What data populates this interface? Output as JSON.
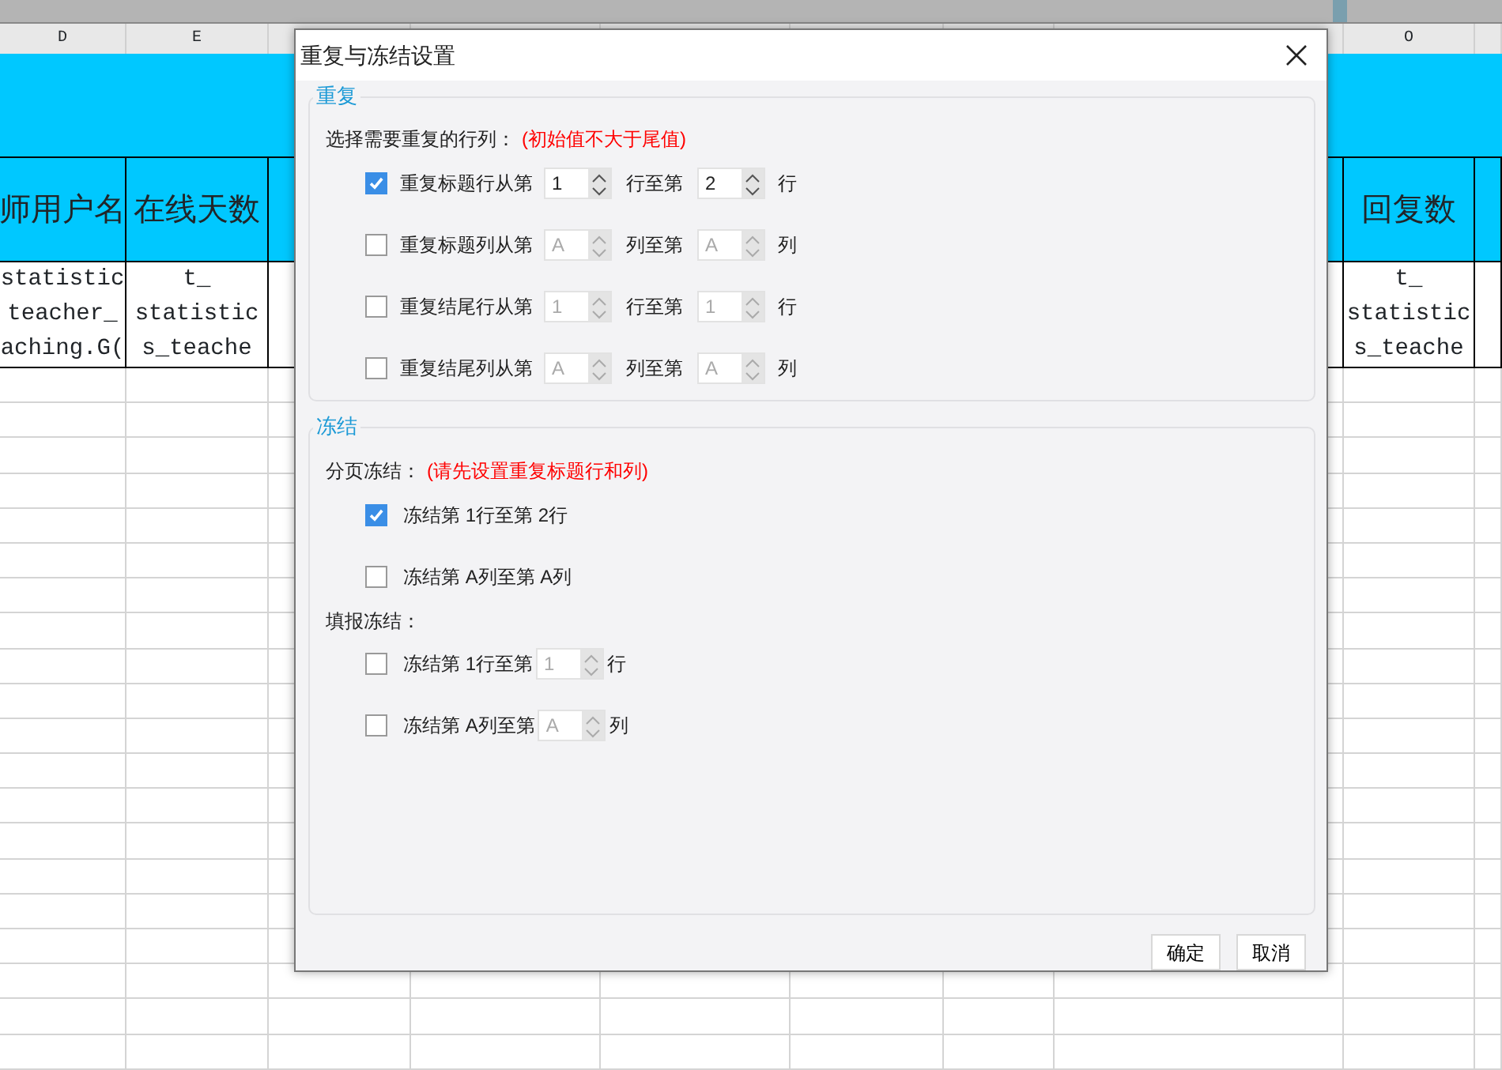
{
  "sheet": {
    "left_columns": [
      {
        "letter": "D",
        "heading": "师用户名",
        "cell": [
          "statistic",
          "teacher_",
          "aching.G("
        ]
      },
      {
        "letter": "E",
        "heading": "在线天数",
        "cell": [
          "t_",
          "statistic",
          "s_teache"
        ]
      }
    ],
    "right_columns": [
      {
        "letter": "O",
        "heading": "回复数",
        "cell": [
          "t_",
          "statistic",
          "s_teache"
        ]
      }
    ]
  },
  "window": {
    "title": "重复与冻结设置"
  },
  "repeat": {
    "legend": "重复",
    "prompt": "选择需要重复的行列：",
    "hint": "(初始值不大于尾值)",
    "rows": [
      {
        "checked": true,
        "label": "重复标题行从第",
        "from": "1",
        "middle": "行至第",
        "to": "2",
        "unit": "行"
      },
      {
        "checked": false,
        "label": "重复标题列从第",
        "from": "A",
        "middle": "列至第",
        "to": "A",
        "unit": "列"
      },
      {
        "checked": false,
        "label": "重复结尾行从第",
        "from": "1",
        "middle": "行至第",
        "to": "1",
        "unit": "行"
      },
      {
        "checked": false,
        "label": "重复结尾列从第",
        "from": "A",
        "middle": "列至第",
        "to": "A",
        "unit": "列"
      }
    ]
  },
  "freeze": {
    "legend": "冻结",
    "page_label": "分页冻结：",
    "page_hint": "(请先设置重复标题行和列)",
    "page_rows": [
      {
        "checked": true,
        "label": "冻结第 1行至第 2行"
      },
      {
        "checked": false,
        "label": "冻结第 A列至第 A列"
      }
    ],
    "fill_label": "填报冻结：",
    "fill_rows": [
      {
        "checked": false,
        "label": "冻结第 1行至第",
        "value": "1",
        "unit": "行"
      },
      {
        "checked": false,
        "label": "冻结第 A列至第",
        "value": "A",
        "unit": "列"
      }
    ]
  },
  "buttons": [
    "确定",
    "取消"
  ]
}
